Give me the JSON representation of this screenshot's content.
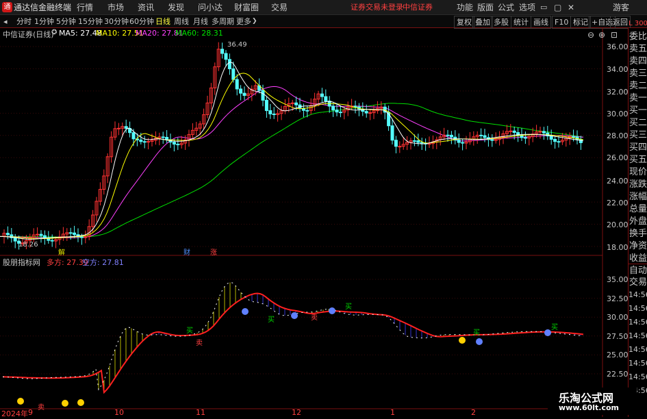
{
  "app": {
    "title": "通达信金融终端",
    "logo_icon": "tdx-logo-icon",
    "menu": [
      "行情",
      "市场",
      "资讯",
      "发现",
      "问小达",
      "财富圈",
      "交易"
    ],
    "notice": "证券交易未登录",
    "broker": "中信证券",
    "right_menu": [
      "功能",
      "版面",
      "公式",
      "选项"
    ],
    "user": "游客"
  },
  "toolbar": {
    "periods": [
      "分时",
      "1分钟",
      "5分钟",
      "15分钟",
      "30分钟",
      "60分钟",
      "日线",
      "周线",
      "月线",
      "多周期",
      "更多"
    ],
    "active_period": "日线",
    "right_buttons": [
      "复权",
      "叠加",
      "多股",
      "统计",
      "画线",
      "F10",
      "标记",
      "+自选",
      "返回"
    ]
  },
  "main_chart": {
    "stock_title": "中信证券(日线)",
    "ma5": "MA5: 27.48",
    "ma10": "MA10: 27.51",
    "ma20": "MA20: 27.81",
    "ma60": "MA60: 28.31",
    "high_label": "36.49",
    "low_label": "18.26",
    "price_ticks": [
      "36.00",
      "34.00",
      "32.00",
      "30.00",
      "28.00",
      "26.00",
      "24.00",
      "22.00",
      "20.00",
      "18.00"
    ],
    "events": [
      "解",
      "财",
      "涨"
    ],
    "colors": {
      "ma5": "#ffffff",
      "ma10": "#ffff00",
      "ma20": "#ff40ff",
      "ma60": "#00e000",
      "up": "#ff3232",
      "down": "#54fcfc"
    }
  },
  "indicator": {
    "name": "股朋指标网",
    "long_label": "多方: 27.39",
    "short_label": "空方: 27.81",
    "ticks": [
      "35.00",
      "32.50",
      "30.00",
      "27.50",
      "25.00",
      "22.50"
    ],
    "buy_label": "买",
    "sell_label": "卖"
  },
  "xaxis": {
    "labels": [
      "2024年",
      "9",
      "10",
      "11",
      "12",
      "1",
      "2"
    ]
  },
  "side_panel": {
    "top": "L 300",
    "labels": [
      "委比",
      "卖五",
      "卖四",
      "卖三",
      "卖二",
      "卖一",
      "买一",
      "买二",
      "买三",
      "买四",
      "买五",
      "现价",
      "涨跌",
      "涨幅",
      "总量",
      "外盘",
      "换手",
      "净资",
      "收益"
    ],
    "mid": [
      "自动",
      "交易"
    ],
    "times": [
      "14:56",
      "14:56",
      "14:56",
      "14:56",
      "14:56",
      "14:56",
      "14:56",
      "14:56",
      "14:56"
    ]
  },
  "watermark": {
    "line1": "乐淘公式网",
    "line2": "www.60lt.com"
  }
}
